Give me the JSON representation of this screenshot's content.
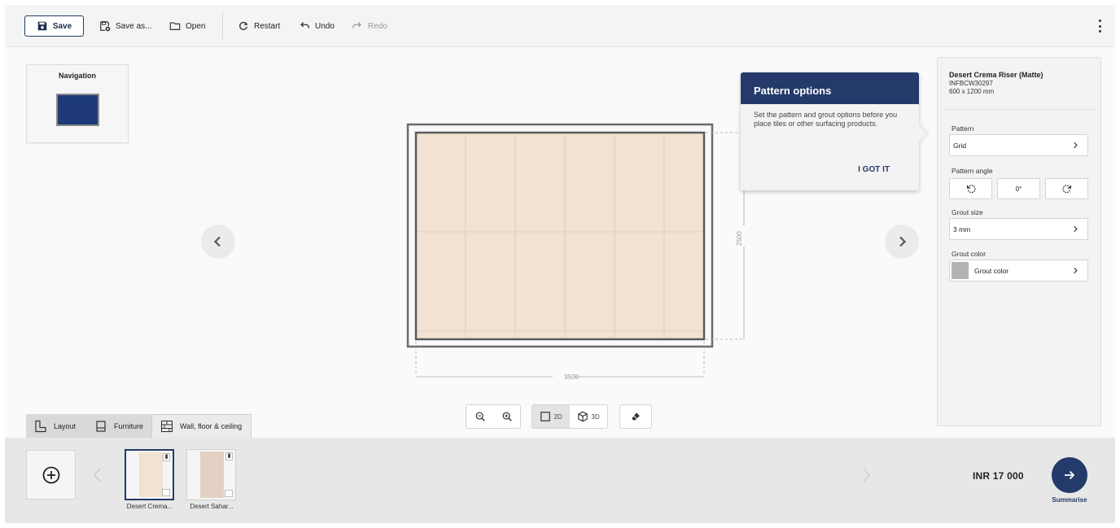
{
  "toolbar": {
    "save_label": "Save",
    "save_as_label": "Save as...",
    "open_label": "Open",
    "restart_label": "Restart",
    "undo_label": "Undo",
    "redo_label": "Redo"
  },
  "navigation": {
    "title": "Navigation"
  },
  "canvas": {
    "width_dim": "3500",
    "height_dim": "2500"
  },
  "popover": {
    "title": "Pattern options",
    "text": "Set the pattern and grout options before you place tiles or other surfacing products.",
    "button": "I GOT IT"
  },
  "panel": {
    "product_name": "Desert Crema Riser (Matte)",
    "product_code": "INFBCW30297",
    "product_size": "600 x 1200 mm",
    "pattern_label": "Pattern",
    "pattern_value": "Grid",
    "angle_label": "Pattern angle",
    "angle_value": "0°",
    "grout_size_label": "Grout size",
    "grout_size_value": "3 mm",
    "grout_color_label": "Grout color",
    "grout_color_value": "Grout color"
  },
  "tabs": [
    {
      "label": "Layout"
    },
    {
      "label": "Furniture"
    },
    {
      "label": "Wall, floor & ceiling"
    }
  ],
  "view_controls": {
    "two_d": "2D",
    "three_d": "3D"
  },
  "tray": {
    "tiles": [
      {
        "label": "Desert Crema..."
      },
      {
        "label": "Desert Sahar..."
      }
    ],
    "price": "INR  17 000",
    "summarise_label": "Summarise"
  },
  "colors": {
    "accent": "#233a6a",
    "tile_crema": "#f1e2d1",
    "tile_sahara": "#e2d0c2",
    "grout": "#b3b3b3"
  }
}
